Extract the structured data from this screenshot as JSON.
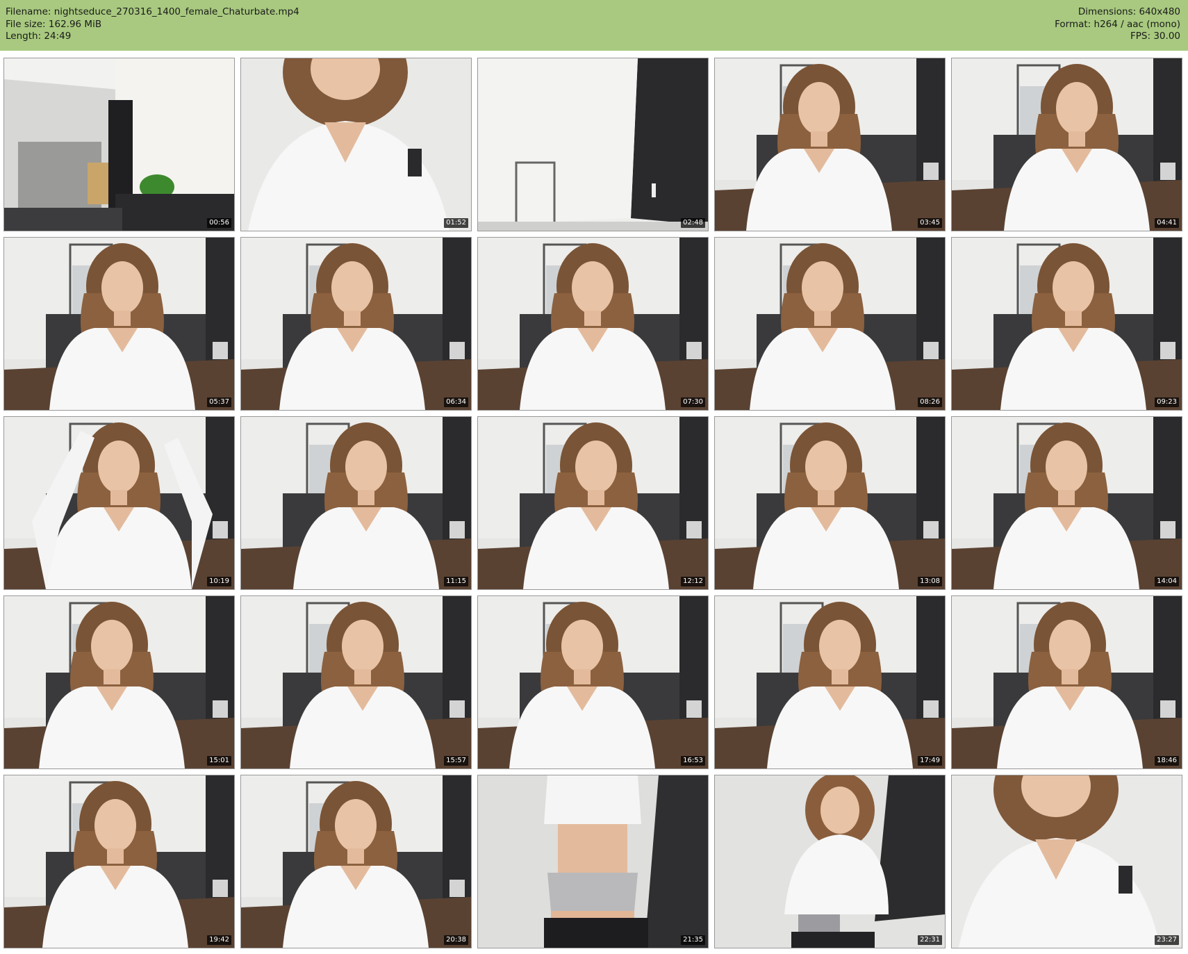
{
  "header": {
    "filename_line": "Filename: nightseduce_270316_1400_female_Chaturbate.mp4",
    "filesize_line": "File size: 162.96 MiB",
    "length_line": "Length: 24:49",
    "dimensions_line": "Dimensions: 640x480",
    "format_line": "Format: h264 / aac (mono)",
    "fps_line": "FPS: 30.00",
    "bar_color": "#a8c97f"
  },
  "frames": [
    {
      "time": "00:56",
      "scene": "room"
    },
    {
      "time": "01:52",
      "scene": "closeup"
    },
    {
      "time": "02:48",
      "scene": "empty"
    },
    {
      "time": "03:45",
      "scene": "person"
    },
    {
      "time": "04:41",
      "scene": "person"
    },
    {
      "time": "05:37",
      "scene": "person"
    },
    {
      "time": "06:34",
      "scene": "person"
    },
    {
      "time": "07:30",
      "scene": "person"
    },
    {
      "time": "08:26",
      "scene": "person"
    },
    {
      "time": "09:23",
      "scene": "person"
    },
    {
      "time": "10:19",
      "scene": "arms-up"
    },
    {
      "time": "11:15",
      "scene": "person"
    },
    {
      "time": "12:12",
      "scene": "person"
    },
    {
      "time": "13:08",
      "scene": "person"
    },
    {
      "time": "14:04",
      "scene": "person"
    },
    {
      "time": "15:01",
      "scene": "person"
    },
    {
      "time": "15:57",
      "scene": "person"
    },
    {
      "time": "16:53",
      "scene": "person"
    },
    {
      "time": "17:49",
      "scene": "person"
    },
    {
      "time": "18:46",
      "scene": "person"
    },
    {
      "time": "19:42",
      "scene": "person"
    },
    {
      "time": "20:38",
      "scene": "person"
    },
    {
      "time": "21:35",
      "scene": "torso"
    },
    {
      "time": "22:31",
      "scene": "standing"
    },
    {
      "time": "23:27",
      "scene": "closeup"
    }
  ]
}
